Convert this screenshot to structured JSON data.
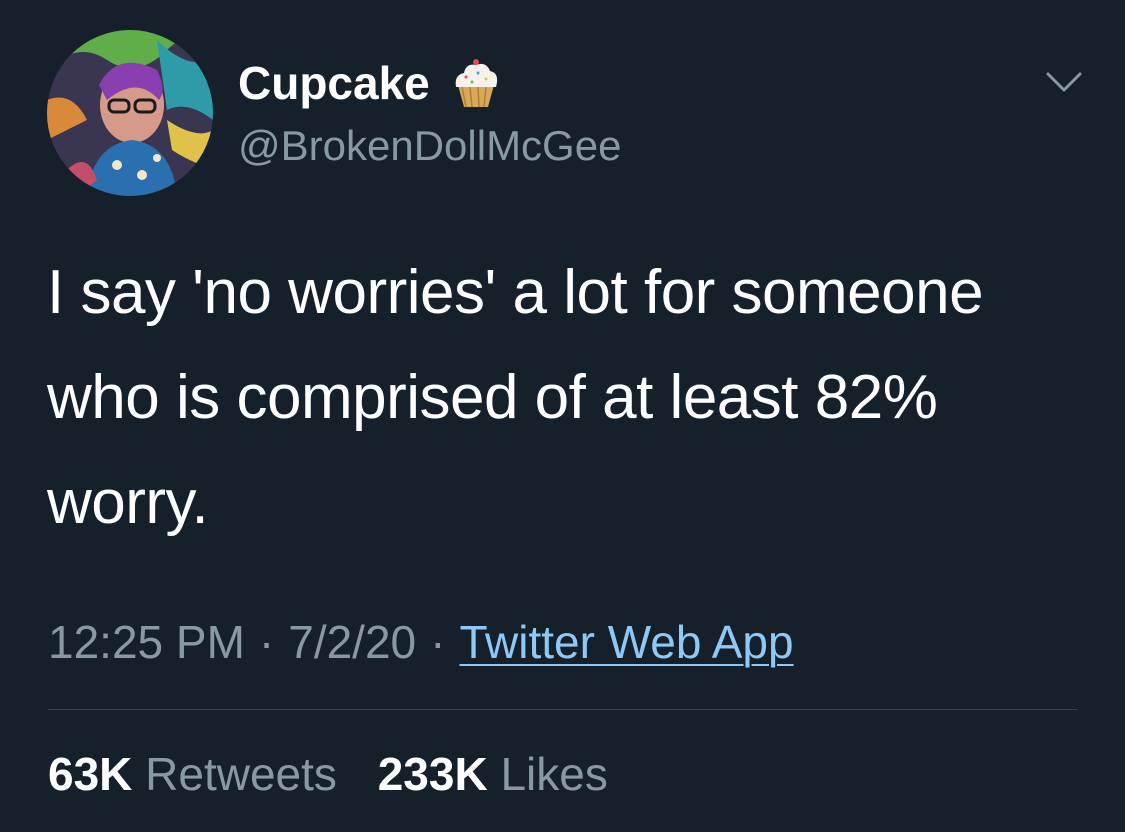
{
  "user": {
    "display_name": "Cupcake",
    "handle": "@BrokenDollMcGee",
    "badge_icon": "cupcake-emoji-icon",
    "avatar_icon": "profile-avatar"
  },
  "tweet": {
    "text": "I say 'no worries' a lot for someone who is comprised of at least 82% worry.",
    "time": "12:25 PM",
    "date": "7/2/20",
    "source": "Twitter Web App",
    "separator": "·"
  },
  "stats": {
    "retweets_count": "63K",
    "retweets_label": "Retweets",
    "likes_count": "233K",
    "likes_label": "Likes"
  },
  "theme": {
    "background": "#15202b",
    "secondary_text": "#8899a6",
    "link": "#8ec8f6",
    "divider": "#38444d"
  }
}
